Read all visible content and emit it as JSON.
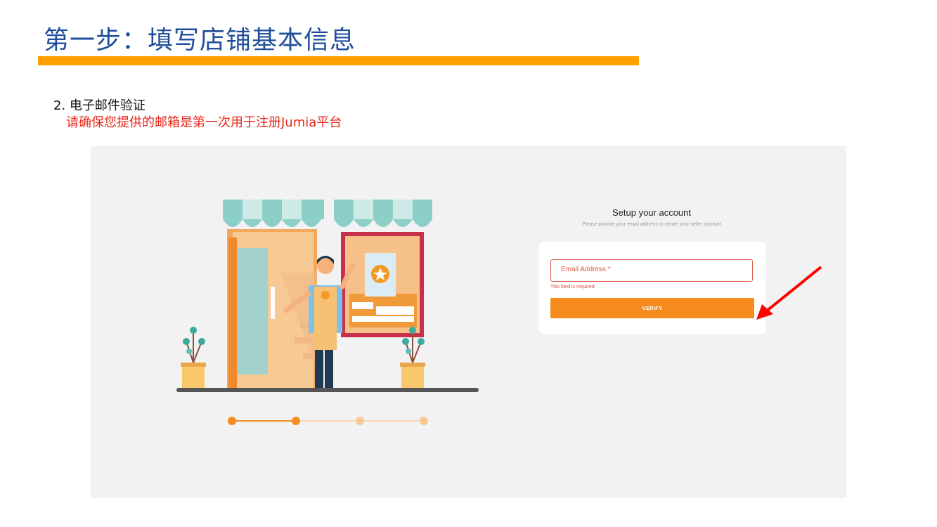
{
  "slide": {
    "title": "第一步：填写店铺基本信息",
    "step_label": "2. 电子邮件验证",
    "step_note": "请确保您提供的邮箱是第一次用于注册Jumia平台"
  },
  "form": {
    "heading": "Setup your account",
    "subheading": "Please provide your email address to create your seller account",
    "email_placeholder": "Email Address *",
    "error_text": "This field is required",
    "verify_label": "VERIFY"
  },
  "progress": {
    "total_steps": 4,
    "current_step": 2
  },
  "colors": {
    "title_blue": "#1f4e9a",
    "title_bar": "#ff9f00",
    "note_red": "#e8261a",
    "accent_orange": "#f68b1e",
    "error_red": "#e05a4a",
    "arrow_red": "#ff0000"
  },
  "icons": [
    "storefront-illustration",
    "red-arrow-annotation"
  ]
}
